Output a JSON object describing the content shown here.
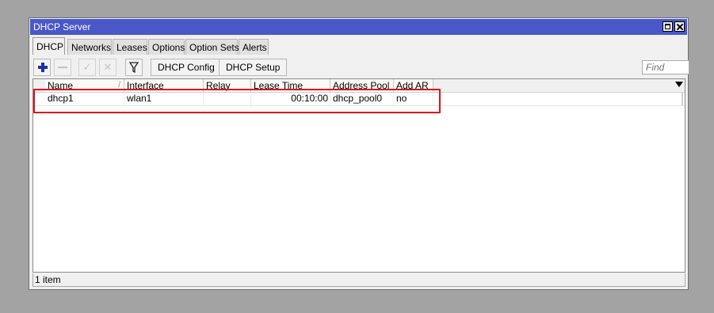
{
  "window": {
    "title": "DHCP Server"
  },
  "tabs": [
    {
      "label": "DHCP",
      "active": true
    },
    {
      "label": "Networks"
    },
    {
      "label": "Leases"
    },
    {
      "label": "Options"
    },
    {
      "label": "Option Sets"
    },
    {
      "label": "Alerts"
    }
  ],
  "toolbar": {
    "add_icon": "plus-icon",
    "remove_icon": "minus-icon",
    "enable_icon": "check-icon",
    "disable_icon": "cross-icon",
    "filter_icon": "filter-icon",
    "dhcp_config_label": "DHCP Config",
    "dhcp_setup_label": "DHCP Setup",
    "find_placeholder": "Find"
  },
  "table": {
    "columns": [
      "Name",
      "Interface",
      "Relay",
      "Lease Time",
      "Address Pool",
      "Add AR"
    ],
    "rows": [
      {
        "name": "dhcp1",
        "interface": "wlan1",
        "relay": "",
        "lease_time": "00:10:00",
        "address_pool": "dhcp_pool0",
        "add_ar": "no"
      }
    ]
  },
  "status": {
    "item_count": "1 item"
  },
  "colors": {
    "titlebar": "#4a57c9",
    "highlight": "#e0101a",
    "accent_icon": "#1f2fa8"
  }
}
